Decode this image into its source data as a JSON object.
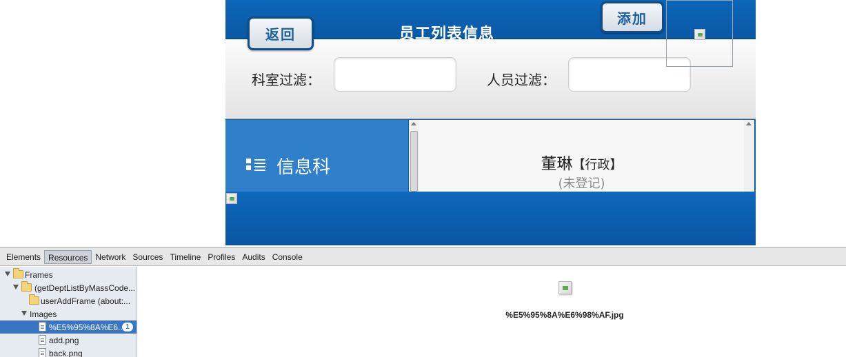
{
  "app": {
    "back_label": "返回",
    "title": "员工列表信息",
    "add_label": "添加",
    "filters": {
      "dept_label": "科室过滤：",
      "dept_value": "",
      "user_label": "人员过滤：",
      "user_value": ""
    },
    "dept_list": [
      {
        "name": "信息科",
        "icon": "list-icon"
      }
    ],
    "user_list": [
      {
        "name": "董琳",
        "role": "【行政】",
        "status": "(未登记)"
      }
    ],
    "colors": {
      "header": "#0b5eab",
      "dept_panel": "#2f7fca",
      "button_text": "#1a5f9e"
    }
  },
  "devtools": {
    "tabs": [
      "Elements",
      "Resources",
      "Network",
      "Sources",
      "Timeline",
      "Profiles",
      "Audits",
      "Console"
    ],
    "active_tab": "Resources",
    "tree": [
      {
        "label": "Frames",
        "icon": "folder-icon",
        "expanded": true
      },
      {
        "label": "(getDeptListByMassCode...",
        "icon": "folder-icon",
        "expanded": true
      },
      {
        "label": "userAddFrame (about:...",
        "icon": "folder-icon"
      },
      {
        "label": "Images",
        "expanded": true
      },
      {
        "label": "%E5%95%8A%E6...",
        "icon": "file-icon",
        "selected": true,
        "badge": "1"
      },
      {
        "label": "add.png",
        "icon": "image-file-icon"
      },
      {
        "label": "back.png",
        "icon": "image-file-icon"
      }
    ],
    "preview_caption": "%E5%95%8A%E6%98%AF.jpg"
  }
}
